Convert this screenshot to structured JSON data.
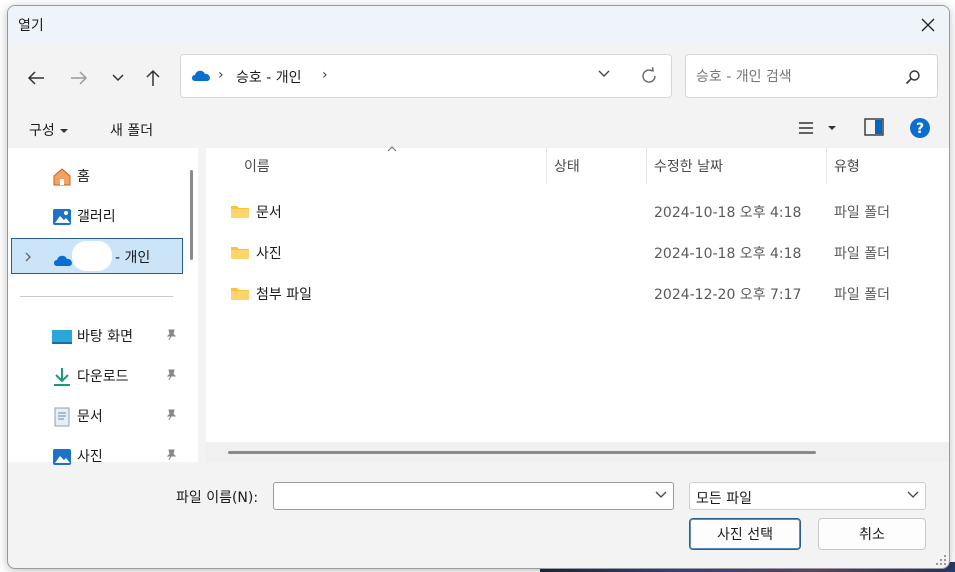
{
  "window": {
    "title": "열기"
  },
  "address": {
    "path_label": "승호 - 개인"
  },
  "search": {
    "placeholder": "승호 - 개인 검색"
  },
  "commands": {
    "organize": "구성",
    "new_folder": "새 폴더"
  },
  "nav": {
    "items": [
      {
        "label": "홈",
        "icon": "home-icon"
      },
      {
        "label": "갤러리",
        "icon": "gallery-icon"
      },
      {
        "label": "- 개인",
        "icon": "onedrive-icon",
        "selected": true
      }
    ],
    "quick_access": [
      {
        "label": "바탕 화면",
        "icon": "desktop-icon"
      },
      {
        "label": "다운로드",
        "icon": "download-icon"
      },
      {
        "label": "문서",
        "icon": "document-icon"
      },
      {
        "label": "사진",
        "icon": "pictures-icon"
      }
    ]
  },
  "columns": {
    "name": "이름",
    "status": "상태",
    "modified": "수정한 날짜",
    "type": "유형"
  },
  "files": [
    {
      "name": "문서",
      "modified": "2024-10-18 오후 4:18",
      "type": "파일 폴더"
    },
    {
      "name": "사진",
      "modified": "2024-10-18 오후 4:18",
      "type": "파일 폴더"
    },
    {
      "name": "첨부 파일",
      "modified": "2024-12-20 오후 7:17",
      "type": "파일 폴더"
    }
  ],
  "footer": {
    "filename_label": "파일 이름(N):",
    "filename_value": "",
    "filetype_value": "모든 파일",
    "open_button": "사진 선택",
    "cancel_button": "취소"
  },
  "colors": {
    "accent": "#0067c0",
    "selected_bg": "#cce4f7",
    "folder": "#f8c23a"
  }
}
